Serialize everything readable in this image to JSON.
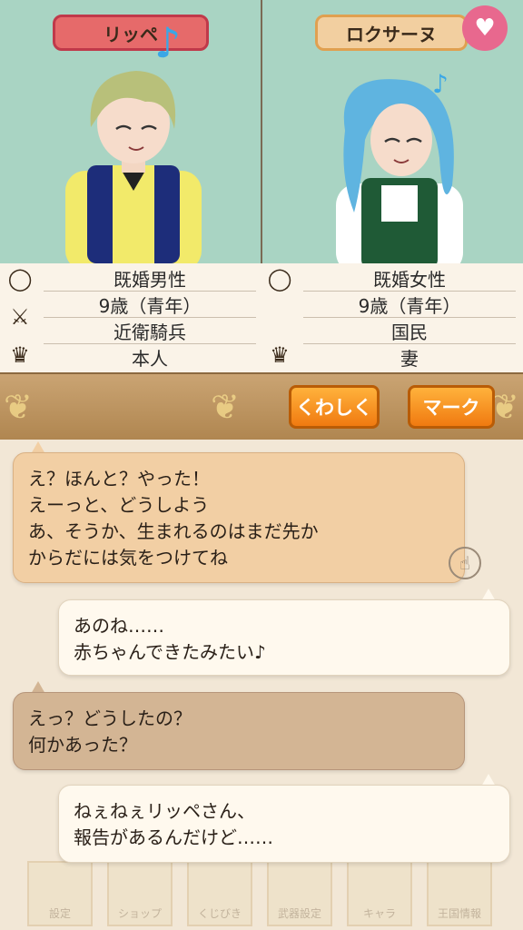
{
  "left_character": {
    "name": "リッペ",
    "status": "既婚男性",
    "age": "9歳（青年）",
    "job": "近衛騎兵",
    "relation": "本人"
  },
  "right_character": {
    "name": "ロクサーヌ",
    "status": "既婚女性",
    "age": "9歳（青年）",
    "job": "国民",
    "relation": "妻"
  },
  "toolbar": {
    "details_label": "くわしく",
    "mark_label": "マーク"
  },
  "messages": [
    {
      "text": "え？ほんと？やった！\nえーっと、どうしよう\nあ、そうか、生まれるのはまだ先か\nからだには気をつけてね"
    },
    {
      "text": "あのね……\n赤ちゃんできたみたい♪"
    },
    {
      "text": "えっ？どうしたの？\n何かあった？"
    },
    {
      "text": "ねぇねぇリッペさん、\n報告があるんだけど……"
    }
  ],
  "menu": {
    "items": [
      "設定",
      "ショップ",
      "くじびき",
      "武器設定",
      "キャラ",
      "王国情報"
    ]
  },
  "colors": {
    "portrait_bg": "#a9d4c3",
    "accent_orange": "#f07a10",
    "heart_pink": "#e8688e"
  }
}
